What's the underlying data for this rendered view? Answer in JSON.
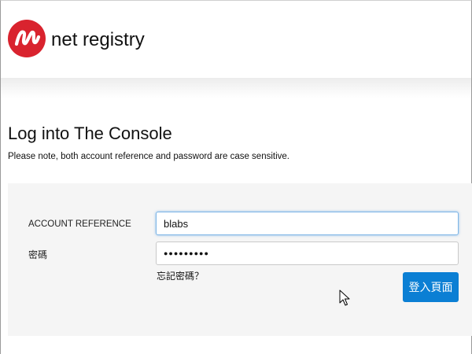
{
  "header": {
    "brand_name": "net registry",
    "logo_icon": "net-registry-logo-icon",
    "logo_color": "#d9232e"
  },
  "main": {
    "title": "Log into The Console",
    "note": "Please note, both account reference and password are case sensitive."
  },
  "form": {
    "account_label": "ACCOUNT REFERENCE",
    "account_value": "blabs",
    "password_label": "密碼",
    "password_value": "●●●●●●●●●",
    "forgot_password": "忘記密碼？",
    "login_button": "登入頁面",
    "button_color": "#0b7fd4"
  },
  "cursor_icon": "mouse-pointer-icon"
}
